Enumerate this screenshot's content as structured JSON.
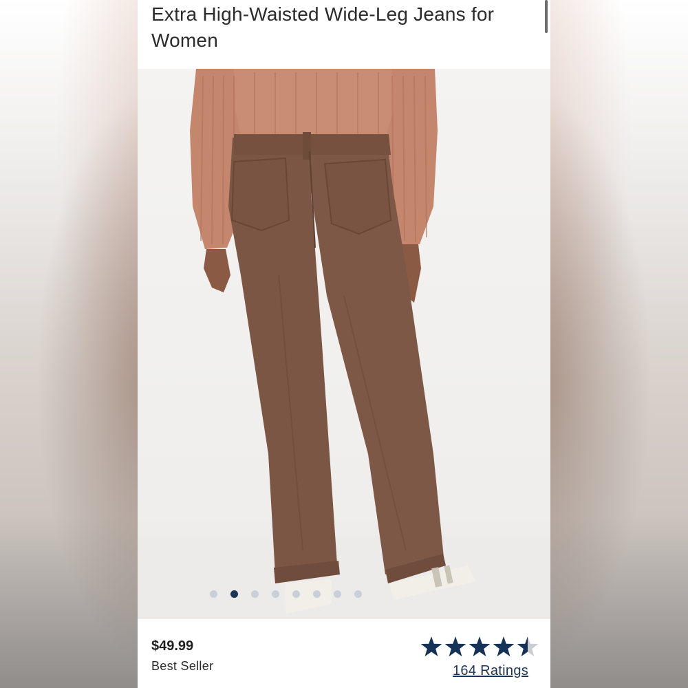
{
  "product": {
    "title": "Extra High-Waisted Wide-Leg Jeans for Women",
    "price": "$49.99",
    "badge": "Best Seller",
    "rating_value": 4.5,
    "rating_max": 5,
    "ratings_link": "164 Ratings"
  },
  "gallery": {
    "image_description_icon": "product-photo",
    "dot_count": 8,
    "active_index": 1
  },
  "colors": {
    "star_fill": "#163257",
    "star_empty": "#c9ccd1",
    "dot_active": "#1b3557",
    "dot_inactive": "#c9cfd8",
    "pants": "#7a5644",
    "sweater": "#c48c74"
  }
}
